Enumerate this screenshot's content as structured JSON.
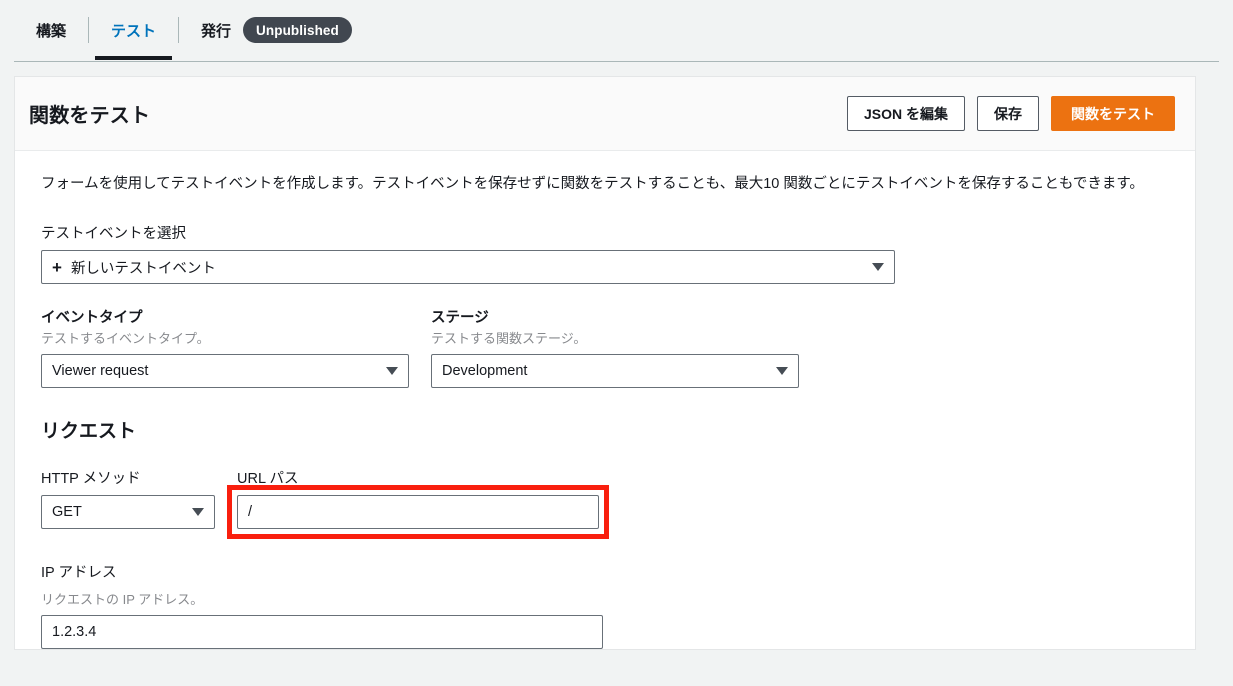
{
  "tabs": [
    {
      "label": "構築",
      "active": false
    },
    {
      "label": "テスト",
      "active": true
    },
    {
      "label": "発行",
      "active": false
    }
  ],
  "publish_badge": "Unpublished",
  "card": {
    "title": "関数をテスト",
    "buttons": {
      "edit_json": "JSON を編集",
      "save": "保存",
      "test_function": "関数をテスト"
    },
    "description": "フォームを使用してテストイベントを作成します。テストイベントを保存せずに関数をテストすることも、最大10 関数ごとにテストイベントを保存することもできます。",
    "fields": {
      "test_event": {
        "label": "テストイベントを選択",
        "value": "新しいテストイベント",
        "icon": "plus-icon"
      },
      "event_type": {
        "label": "イベントタイプ",
        "hint": "テストするイベントタイプ。",
        "value": "Viewer request"
      },
      "stage": {
        "label": "ステージ",
        "hint": "テストする関数ステージ。",
        "value": "Development"
      },
      "http_method": {
        "label": "HTTP メソッド",
        "value": "GET"
      },
      "url_path": {
        "label": "URL パス",
        "value": "/"
      },
      "ip_address": {
        "label": "IP アドレス",
        "hint": "リクエストの IP アドレス。",
        "value": "1.2.3.4"
      }
    },
    "request_section_title": "リクエスト"
  },
  "colors": {
    "accent_primary": "#ec7211",
    "tab_active": "#0073bb",
    "badge_bg": "#414750",
    "highlight": "#f91f0e",
    "page_bg": "#f1f3f3"
  }
}
